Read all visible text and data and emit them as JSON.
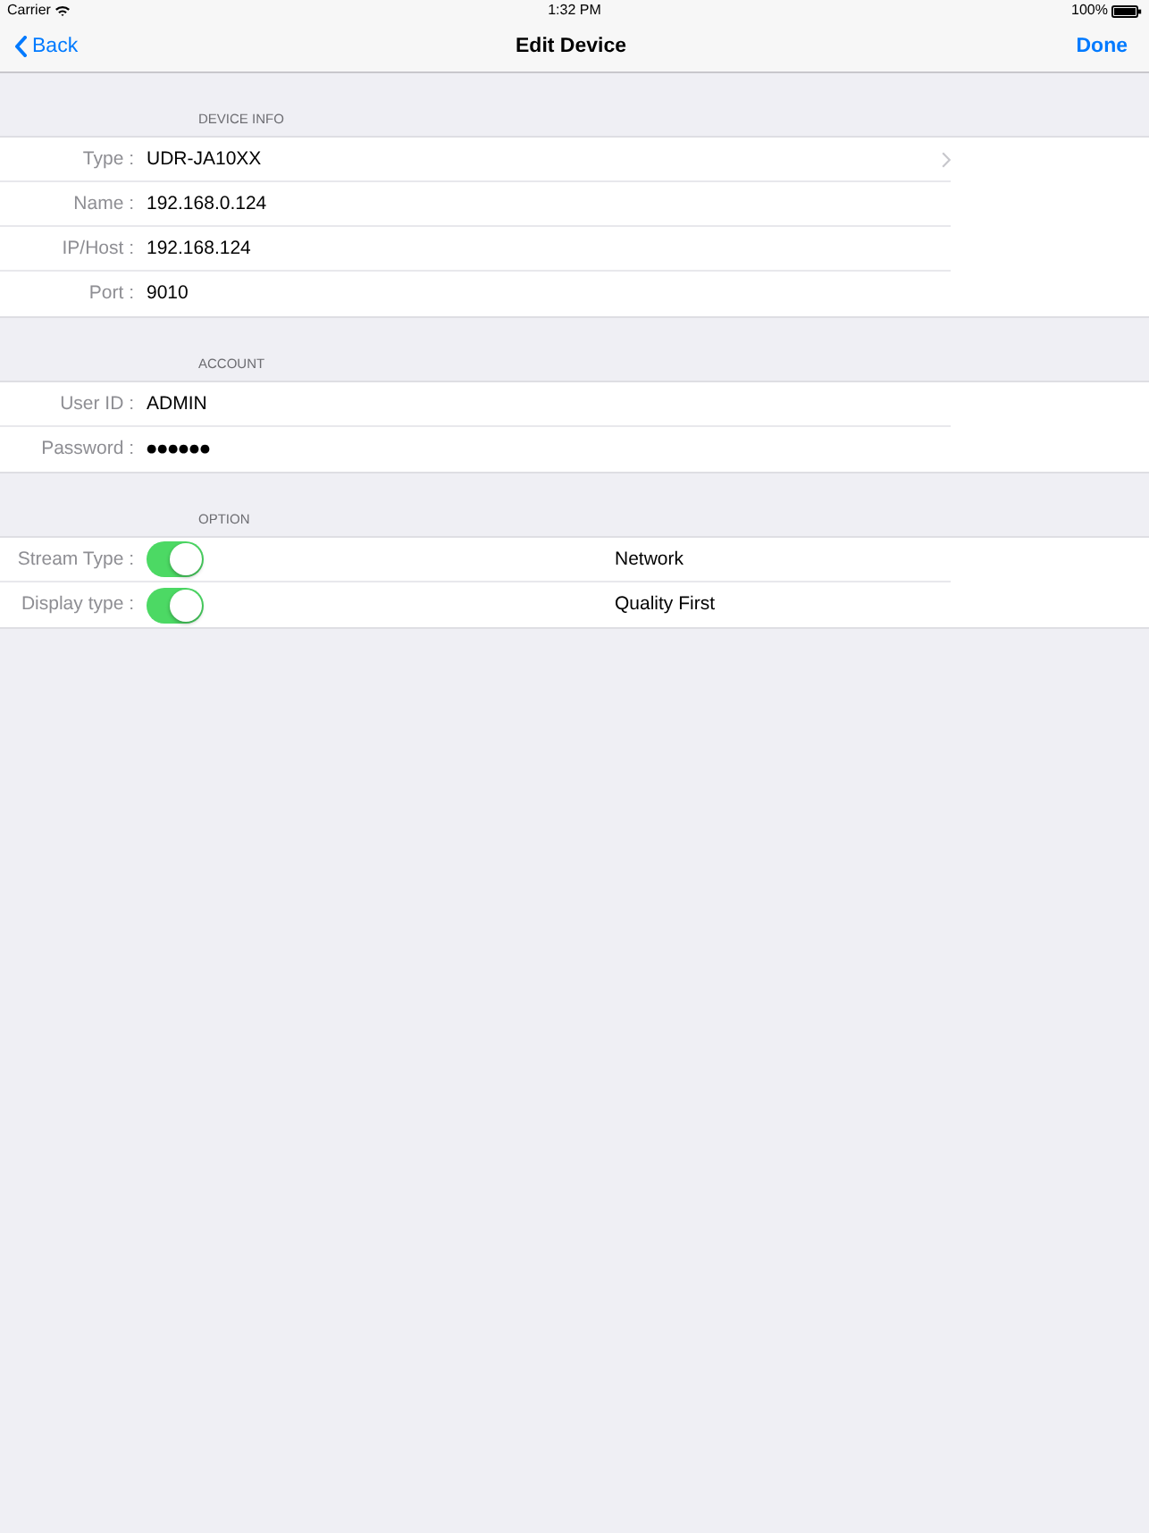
{
  "status_bar": {
    "carrier": "Carrier",
    "time": "1:32 PM",
    "battery": "100%"
  },
  "nav_bar": {
    "back": "Back",
    "title": "Edit Device",
    "done": "Done"
  },
  "sections": [
    {
      "header": "DEVICE INFO",
      "rows": [
        {
          "kind": "disclosure",
          "label": "Type :",
          "value": "UDR-JA10XX"
        },
        {
          "kind": "field",
          "label": "Name :",
          "value": "192.168.0.124"
        },
        {
          "kind": "field",
          "label": "IP/Host :",
          "value": "192.168.124"
        },
        {
          "kind": "field",
          "label": "Port :",
          "value": "9010"
        }
      ]
    },
    {
      "header": "ACCOUNT",
      "rows": [
        {
          "kind": "field",
          "label": "User ID :",
          "value": "ADMIN"
        },
        {
          "kind": "secure",
          "label": "Password :",
          "value": "●●●●●●"
        }
      ]
    },
    {
      "header": "OPTION",
      "rows": [
        {
          "kind": "toggle",
          "label": "Stream Type :",
          "on": true,
          "value": "Network"
        },
        {
          "kind": "toggle",
          "label": "Display type :",
          "on": true,
          "value": "Quality First"
        }
      ]
    }
  ]
}
